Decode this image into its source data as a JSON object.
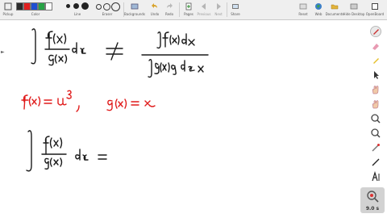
{
  "toolbar": {
    "left_groups": [
      {
        "label": "Pickup"
      },
      {
        "label": "Color"
      },
      {
        "label": "Line"
      },
      {
        "label": "Eraser"
      },
      {
        "label": "Backgrounds"
      },
      {
        "label": "Undo"
      },
      {
        "label": "Redo"
      },
      {
        "label": "Pages"
      },
      {
        "label": "Previous"
      },
      {
        "label": "Next"
      },
      {
        "label": "Share"
      }
    ],
    "right_groups": [
      {
        "label": "Reset"
      },
      {
        "label": "Web"
      },
      {
        "label": "Documents"
      },
      {
        "label": "Hide Desktop"
      },
      {
        "label": "OpenBoard"
      }
    ],
    "colors": [
      "#2b2b2b",
      "#e02020",
      "#1f4fd1",
      "#27a345",
      "#ffffff"
    ]
  },
  "zoom": {
    "value": "9.0 s"
  },
  "colors": {
    "ink": "#1a1a1a",
    "red_ink": "#e01b1b",
    "toolbar_bg": "#efefef"
  }
}
